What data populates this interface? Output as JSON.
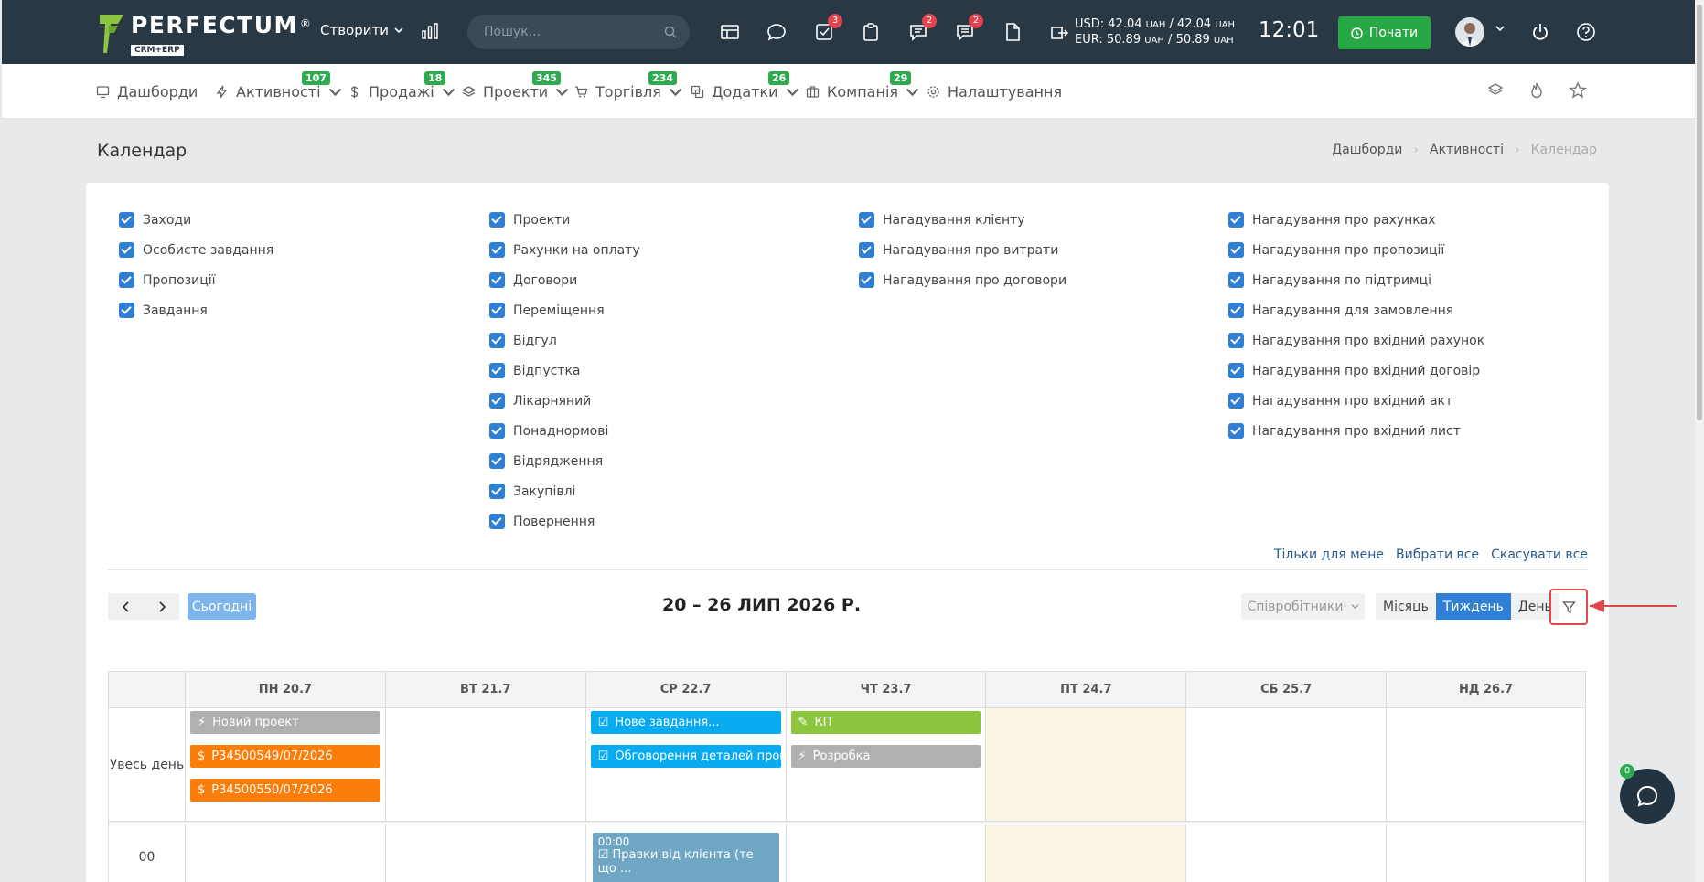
{
  "header": {
    "logo": {
      "name": "PERFECTUM",
      "sub": "CRM+ERP",
      "reg": "®"
    },
    "create_label": "Створити",
    "search_placeholder": "Пошук...",
    "badges": {
      "tasks": "3",
      "chat": "2",
      "messages": "2"
    },
    "currency": {
      "usd": "USD: 42.04",
      "usd_unit1": "UAH",
      "usd_sep": " / 42.04 ",
      "usd_unit2": "UAH",
      "eur": "EUR: 50.89",
      "eur_unit1": "UAH",
      "eur_sep": " / 50.89 ",
      "eur_unit2": "UAH"
    },
    "time": "12:01",
    "start_label": "Почати"
  },
  "menu": {
    "items": [
      {
        "label": "Дашборди",
        "icon": "monitor-icon"
      },
      {
        "label": "Активності",
        "badge": "107",
        "icon": "bolt-icon"
      },
      {
        "label": "Продажі",
        "badge": "18",
        "icon": "dollar-icon"
      },
      {
        "label": "Проекти",
        "badge": "345",
        "icon": "layers-icon"
      },
      {
        "label": "Торгівля",
        "badge": "234",
        "icon": "cart-icon"
      },
      {
        "label": "Додатки",
        "badge": "26",
        "icon": "copy-icon"
      },
      {
        "label": "Компанія",
        "badge": "29",
        "icon": "briefcase-icon"
      },
      {
        "label": "Налаштування",
        "icon": "gear-icon"
      }
    ]
  },
  "page": {
    "title": "Календар",
    "breadcrumb": [
      "Дашборди",
      "Активності",
      "Календар"
    ]
  },
  "filters": {
    "col1": [
      "Заходи",
      "Особисте завдання",
      "Пропозиції",
      "Завдання"
    ],
    "col2": [
      "Проекти",
      "Рахунки на оплату",
      "Договори",
      "Переміщення",
      "Відгул",
      "Відпустка",
      "Лікарняний",
      "Понаднормові",
      "Відрядження",
      "Закупівлі",
      "Повернення"
    ],
    "col3": [
      "Нагадування клієнту",
      "Нагадування про витрати",
      "Нагадування про договори"
    ],
    "col4": [
      "Нагадування про рахунках",
      "Нагадування про пропозиції",
      "Нагадування по підтримці",
      "Нагадування для замовлення",
      "Нагадування про вхідний рахунок",
      "Нагадування про вхідний договір",
      "Нагадування про вхідний акт",
      "Нагадування про вхідний лист"
    ],
    "links": {
      "only_me": "Тільки для мене",
      "select_all": "Вибрати все",
      "cancel_all": "Скасувати все"
    }
  },
  "calendar": {
    "today_label": "Сьогодні",
    "period": "20 – 26 ЛИП 2026 Р.",
    "staff_label": "Співробітники",
    "views": {
      "month": "Місяць",
      "week": "Тиждень",
      "day": "День"
    },
    "days": [
      "ПН 20.7",
      "ВТ 21.7",
      "СР 22.7",
      "ЧТ 23.7",
      "ПТ 24.7",
      "СБ 25.7",
      "НД 26.7"
    ],
    "allday_label": "Увесь день",
    "time_label": "00",
    "events": {
      "mon": [
        "Новий проект",
        "P34500549/07/2026",
        "P34500550/07/2026"
      ],
      "wed": [
        "Нове завдання...",
        "Обговорення деталей пропоз"
      ],
      "thu": [
        "КП",
        "Розробка"
      ]
    },
    "timed_event": {
      "time": "00:00",
      "title": "Правки від клієнта (те що ..."
    }
  },
  "chat_badge": "0"
}
